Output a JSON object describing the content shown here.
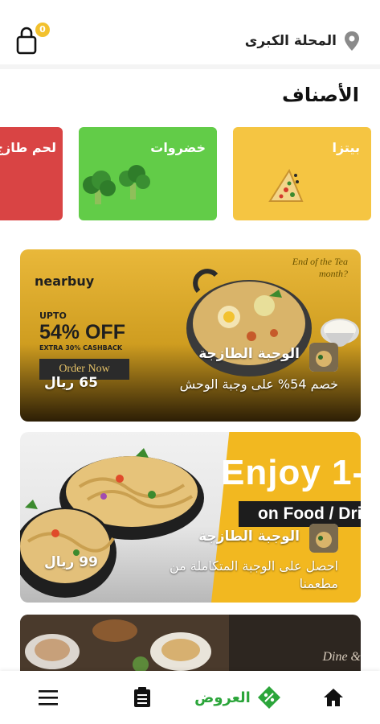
{
  "header": {
    "location": "المحلة الكبرى",
    "cart_count": "0"
  },
  "categories_title": "الأصناف",
  "categories": [
    {
      "label": "بيتزا",
      "color": "#f5c542"
    },
    {
      "label": "خضروات",
      "color": "#62cc48"
    },
    {
      "label": "لحم طازج",
      "color": "#d94444"
    }
  ],
  "offers": [
    {
      "restaurant": "الوجبة الطازجة",
      "description": "خصم 54% على وجبة الوحش",
      "price": "65 ريال",
      "banner": {
        "brand": "nearbuy",
        "upto": "UPTO",
        "percent": "54% OFF",
        "extra": "EXTRA 30% CASHBACK",
        "cta": "Order Now",
        "script": "End of the Tea month?"
      }
    },
    {
      "restaurant": "الوجبة الطازجة",
      "description": "احصل على الوجبة المتكاملة من مطعمنا",
      "price": "99 ريال",
      "banner": {
        "headline": "Enjoy 1-",
        "subline": "on Food / Drin"
      }
    },
    {
      "banner": {
        "text": "Dine &"
      }
    }
  ],
  "bottom_nav": {
    "offers_label": "العروض",
    "accent": "#2ba53a"
  }
}
